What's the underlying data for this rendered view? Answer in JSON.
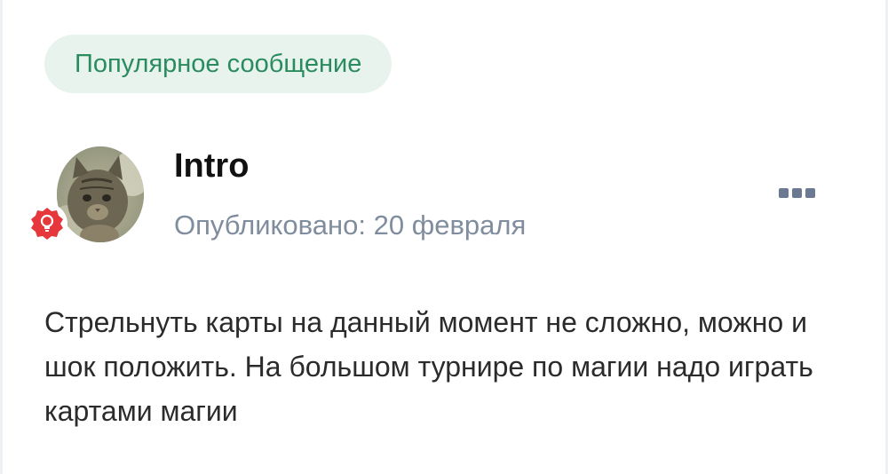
{
  "badge": {
    "label": "Популярное сообщение"
  },
  "post": {
    "author": "Intro",
    "published": "Опубликовано: 20 февраля",
    "text": "Стрельнуть карты на данный момент не сложно, можно и шок положить. На большом турнире по магии надо играть картами магии"
  },
  "icons": {
    "avatar": "cat-photo-avatar",
    "role_badge": "lightbulb-icon",
    "more": "more-options-icon"
  },
  "colors": {
    "badge_bg": "#e8f3ee",
    "badge_text": "#2a8c5e",
    "role_badge": "#e5373c",
    "meta_text": "#7f8d9e",
    "more_icon": "#6b7a92"
  }
}
